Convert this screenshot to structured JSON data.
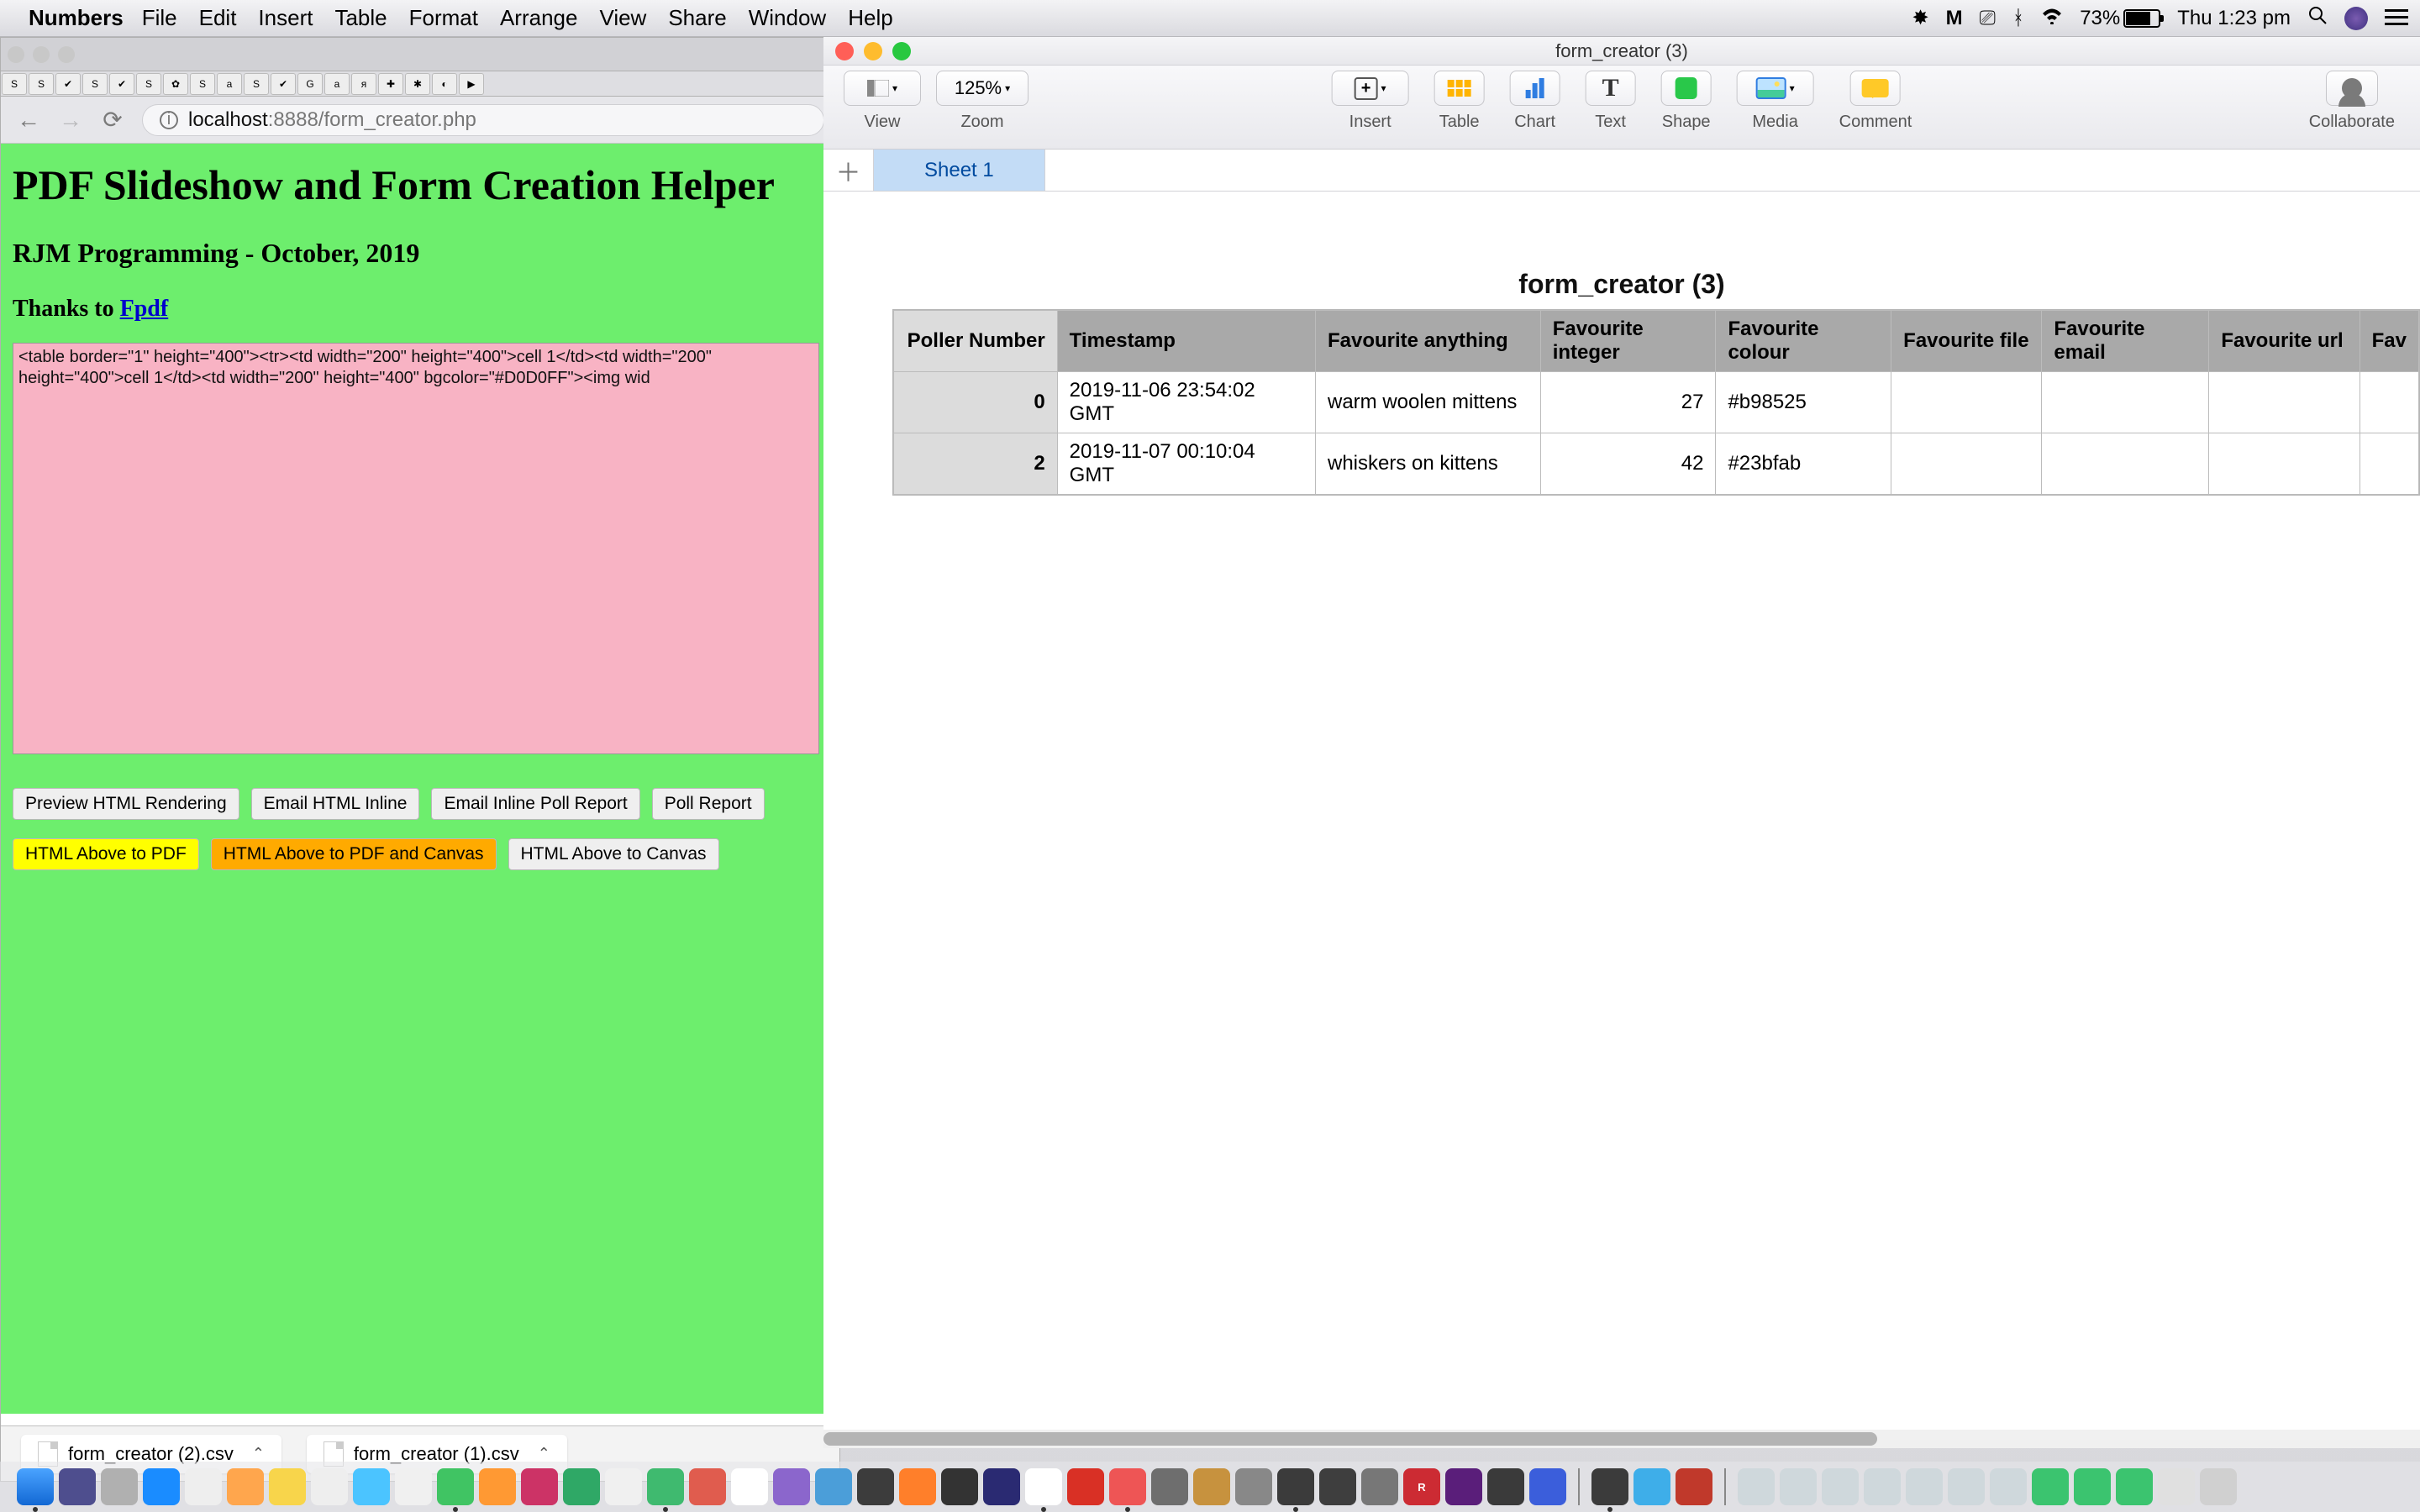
{
  "menubar": {
    "app": "Numbers",
    "items": [
      "File",
      "Edit",
      "Insert",
      "Table",
      "Format",
      "Arrange",
      "View",
      "Share",
      "Window",
      "Help"
    ],
    "battery_pct": "73%",
    "clock": "Thu 1:23 pm"
  },
  "browser": {
    "url_host": "localhost",
    "url_port_path": ":8888/form_creator.php",
    "page": {
      "h1": "PDF Slideshow and Form Creation Helper",
      "h2_line": "RJM Programming - October, 2019",
      "thanks_prefix": "Thanks to ",
      "thanks_link": "Fpdf",
      "code": "<table border=\"1\" height=\"400\"><tr><td width=\"200\" height=\"400\">cell 1</td><td width=\"200\" height=\"400\">cell 1</td><td width=\"200\" height=\"400\" bgcolor=\"#D0D0FF\"><img wid",
      "buttons_row1": [
        "Preview HTML Rendering",
        "Email HTML Inline",
        "Email Inline Poll Report",
        "Poll Report"
      ],
      "buttons_row2": [
        "HTML Above to PDF",
        "HTML Above to PDF and Canvas",
        "HTML Above to Canvas"
      ]
    },
    "downloads": [
      "form_creator (2).csv",
      "form_creator (1).csv"
    ]
  },
  "numbers_win": {
    "title": "form_creator (3)",
    "toolbar": {
      "zoom": "125%",
      "labels": {
        "view": "View",
        "zoom": "Zoom",
        "insert": "Insert",
        "table": "Table",
        "chart": "Chart",
        "text": "Text",
        "shape": "Shape",
        "media": "Media",
        "comment": "Comment",
        "collab": "Collaborate"
      }
    },
    "sheet_tab": "Sheet 1",
    "doc_title": "form_creator (3)",
    "table": {
      "headers": [
        "Poller Number",
        "Timestamp",
        "Favourite anything",
        "Favourite integer",
        "Favourite colour",
        "Favourite file",
        "Favourite email",
        "Favourite url",
        "Fav"
      ],
      "rows": [
        {
          "num": "0",
          "ts": "2019-11-06 23:54:02 GMT",
          "any": "warm woolen mittens",
          "int": "27",
          "col": "#b98525",
          "file": "",
          "email": "",
          "url": ""
        },
        {
          "num": "2",
          "ts": "2019-11-07 00:10:04 GMT",
          "any": "whiskers on kittens",
          "int": "42",
          "col": "#23bfab",
          "file": "",
          "email": "",
          "url": ""
        }
      ]
    }
  }
}
